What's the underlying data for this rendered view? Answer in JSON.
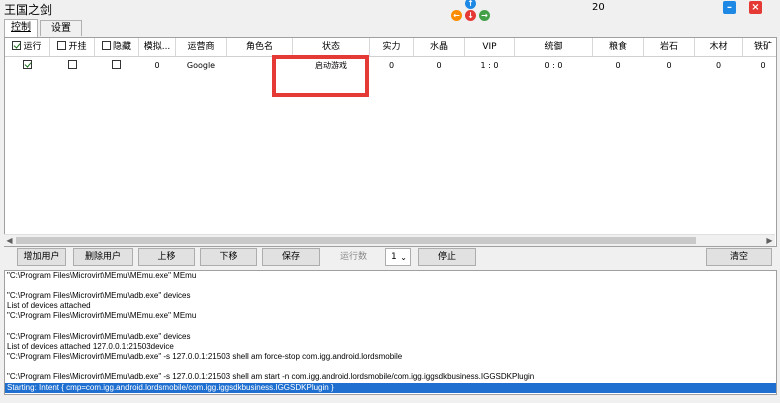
{
  "window": {
    "title": "王国之剑",
    "counter": "20"
  },
  "tabs": [
    {
      "label": "控制"
    },
    {
      "label": "设置"
    }
  ],
  "columns": [
    "运行",
    "开挂",
    "隐藏",
    "模拟...",
    "运营商",
    "角色名",
    "状态",
    "实力",
    "水晶",
    "VIP",
    "统御",
    "粮食",
    "岩石",
    "木材",
    "铁矿"
  ],
  "rows": [
    {
      "run": true,
      "cheat": false,
      "hide": false,
      "emulator": "0",
      "operator": "Google",
      "role": "",
      "status": "启动游戏",
      "power": "0",
      "crystal": "0",
      "vip": "1 : 0",
      "command": "0 : 0",
      "food": "0",
      "stone": "0",
      "wood": "0",
      "iron": "0"
    }
  ],
  "toolbar": {
    "add_user": "增加用户",
    "delete_user": "删除用户",
    "move_up": "上移",
    "move_down": "下移",
    "save": "保存",
    "run_count_label": "运行数",
    "run_count_value": "1",
    "stop": "停止",
    "clear": "清空"
  },
  "log": [
    "\"C:\\Program Files\\Microvirt\\MEmu\\MEmu.exe\" MEmu",
    "",
    "\"C:\\Program Files\\Microvirt\\MEmu\\adb.exe\" devices",
    "List of devices attached",
    "\"C:\\Program Files\\Microvirt\\MEmu\\MEmu.exe\" MEmu",
    "",
    "\"C:\\Program Files\\Microvirt\\MEmu\\adb.exe\" devices",
    "List of devices attached 127.0.0.1:21503device",
    "\"C:\\Program Files\\Microvirt\\MEmu\\adb.exe\" -s 127.0.0.1:21503 shell am force-stop com.igg.android.lordsmobile",
    "",
    "\"C:\\Program Files\\Microvirt\\MEmu\\adb.exe\" -s 127.0.0.1:21503 shell am start -n com.igg.android.lordsmobile/com.igg.iggsdkbusiness.IGGSDKPlugin",
    "Starting: Intent { cmp=com.igg.android.lordsmobile/com.igg.iggsdkbusiness.IGGSDKPlugin }"
  ],
  "colors": {
    "highlight_box": "#e53935",
    "selection": "#1f6fd0",
    "nav_up": "#1e88e5",
    "nav_left": "#fb8c00",
    "nav_down": "#e53935",
    "nav_right": "#43a047",
    "minimize": "#1e88e5",
    "close": "#e53935"
  }
}
